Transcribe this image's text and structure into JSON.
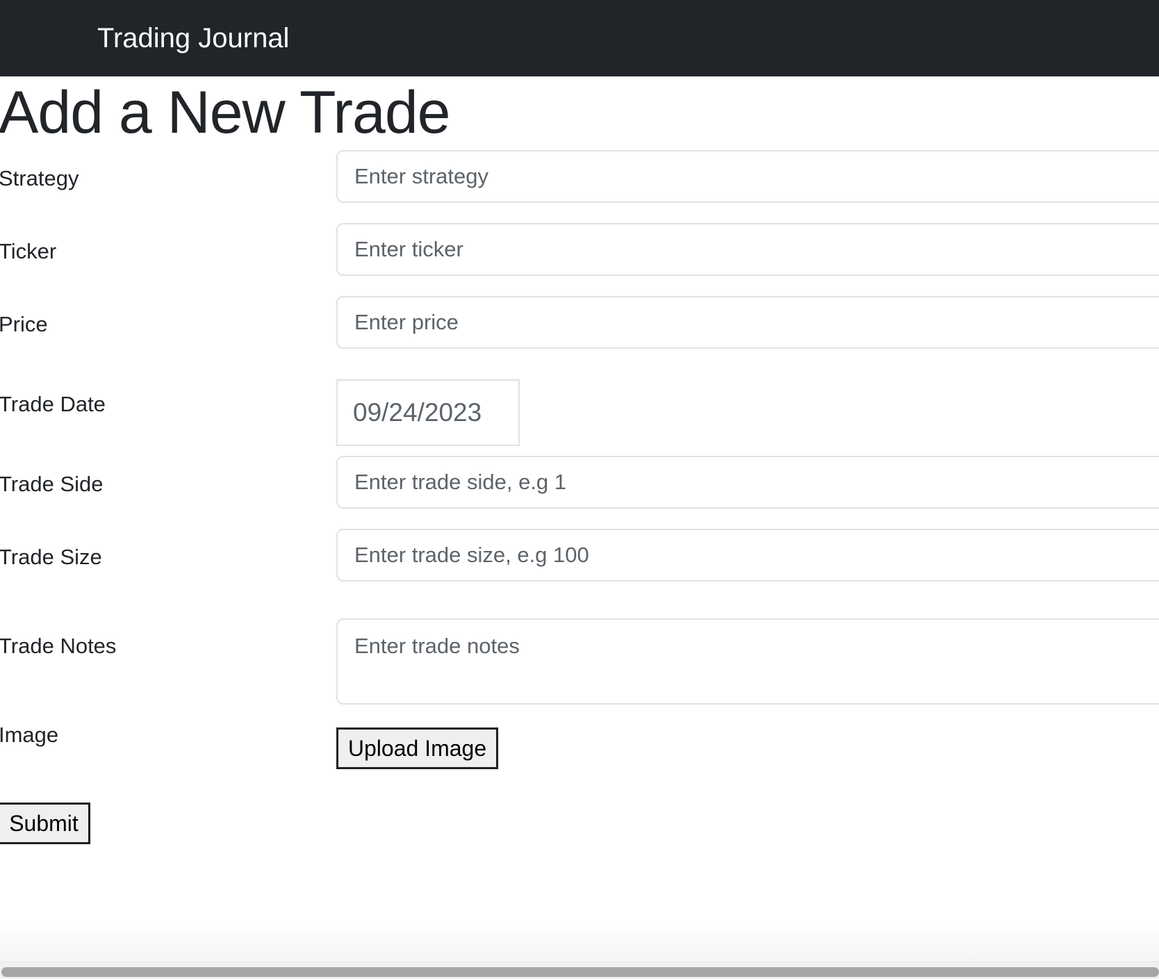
{
  "navbar": {
    "brand": "Trading Journal"
  },
  "page_title": "Add a New Trade",
  "form": {
    "strategy": {
      "label": "Strategy",
      "placeholder": "Enter strategy"
    },
    "ticker": {
      "label": "Ticker",
      "placeholder": "Enter ticker"
    },
    "price": {
      "label": "Price",
      "placeholder": "Enter price"
    },
    "trade_date": {
      "label": "Trade Date",
      "value": "09/24/2023"
    },
    "trade_side": {
      "label": "Trade Side",
      "placeholder": "Enter trade side, e.g 1"
    },
    "trade_size": {
      "label": "Trade Size",
      "placeholder": "Enter trade size, e.g 100"
    },
    "trade_notes": {
      "label": "Trade Notes",
      "placeholder": "Enter trade notes"
    },
    "image": {
      "label": "Image",
      "button_label": "Upload Image"
    },
    "submit_label": "Submit"
  },
  "colors": {
    "navbar_background": "#212529",
    "navbar_text": "#ffffff",
    "input_border": "#dee2e6",
    "placeholder_text": "#5c636a",
    "button_background": "#efefef"
  }
}
